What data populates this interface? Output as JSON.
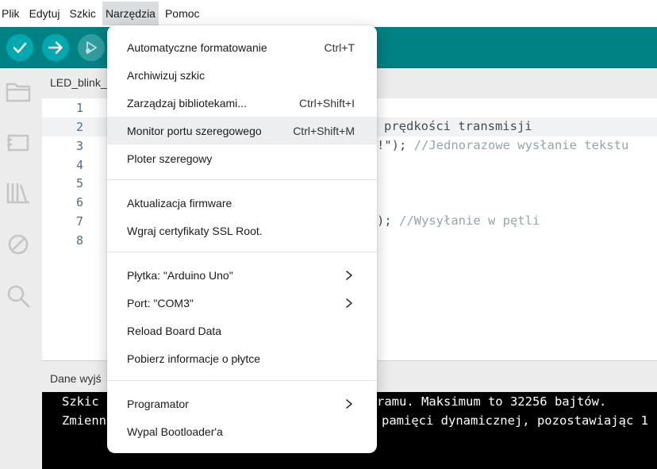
{
  "menubar": {
    "items": [
      {
        "label": "Plik"
      },
      {
        "label": "Edytuj"
      },
      {
        "label": "Szkic"
      },
      {
        "label": "Narzędzia"
      },
      {
        "label": "Pomoc"
      }
    ],
    "active_index": 3
  },
  "toolbar": {
    "buttons": [
      {
        "icon": "checkmark-icon",
        "name": "verify-button"
      },
      {
        "icon": "arrow-right-icon",
        "name": "upload-button"
      },
      {
        "icon": "debug-icon",
        "name": "debug-button"
      }
    ],
    "accent_color": "#008184"
  },
  "sidebar": {
    "icons": [
      "folder-icon",
      "board-icon",
      "library-icon",
      "debug-stop-icon",
      "search-icon"
    ]
  },
  "editor": {
    "tab_label": "LED_blink_",
    "line_numbers": [
      "1",
      "2",
      "3",
      "4",
      "5",
      "6",
      "7",
      "8"
    ],
    "visible_code": {
      "line2": "prędkości transmisji",
      "line3_code": "!\");",
      "line3_comment": " //Jednorazowe wysłanie tekstu",
      "line7_code": ");",
      "line7_comment": " //Wysyłanie w pętli"
    }
  },
  "output": {
    "title": "Dane wyjś",
    "line1_left": "Szkic",
    "line1_right": "ramu. Maksimum to 32256 bajtów.",
    "line2_left": "Zmienn",
    "line2_right": "pamięci dynamicznej, pozostawiając 1"
  },
  "dropdown": {
    "groups": [
      [
        {
          "label": "Automatyczne formatowanie",
          "shortcut": "Ctrl+T"
        },
        {
          "label": "Archiwizuj szkic",
          "shortcut": ""
        },
        {
          "label": "Zarządzaj bibliotekami...",
          "shortcut": "Ctrl+Shift+I"
        },
        {
          "label": "Monitor portu szeregowego",
          "shortcut": "Ctrl+Shift+M",
          "hover": true
        },
        {
          "label": "Ploter szeregowy",
          "shortcut": ""
        }
      ],
      [
        {
          "label": "Aktualizacja firmware",
          "shortcut": ""
        },
        {
          "label": "Wgraj certyfikaty SSL Root.",
          "shortcut": ""
        }
      ],
      [
        {
          "label": "Płytka: \"Arduino Uno\"",
          "submenu": true
        },
        {
          "label": "Port: \"COM3\"",
          "submenu": true
        },
        {
          "label": "Reload Board Data",
          "shortcut": ""
        },
        {
          "label": "Pobierz informacje o płytce",
          "shortcut": ""
        }
      ],
      [
        {
          "label": "Programator",
          "submenu": true
        },
        {
          "label": "Wypal Bootloader'a",
          "shortcut": ""
        }
      ]
    ]
  }
}
